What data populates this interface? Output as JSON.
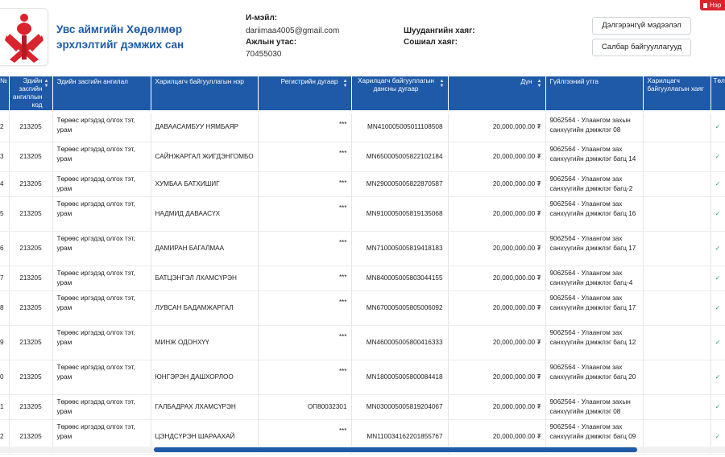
{
  "org": {
    "name": "Увс аймгийн Хөдөлмөр эрхлэлтийг дэмжих сан"
  },
  "contact": {
    "email_label": "И-мэйл:",
    "email_value": "dariimaa4005@gmail.com",
    "phone_label": "Ажлын утас:",
    "phone_value": "70455030",
    "address_label": "Шуудангийн хаяг:",
    "social_label": "Сошиал хаяг:"
  },
  "buttons": {
    "details": "Дэлгэрэнгүй мэдээлэл",
    "branches": "Салбар байгууллагууд",
    "corner": "Нэр"
  },
  "colors": {
    "primary": "#1e5aa8",
    "accent": "#d9232d",
    "success": "#2e9e5b"
  },
  "table": {
    "headers": [
      "№",
      "Эдийн засгийн ангиллын код",
      "Эдийн засгийн ангилал",
      "Харилцагч байгууллагын нэр",
      "Регистрийн дугаар",
      "Харилцагч байгууллагын дансны дугаар",
      "Дүн",
      "Гүйлгээний утга",
      "Харилцагч байгууллагын хаяг",
      "Төлөв"
    ],
    "rows": [
      {
        "no": "2",
        "code": "213205",
        "category": "Төрөөс иргэдэд олгох тэт, урам",
        "name": "ДАВААСАМБУУ НЯМБАЯР",
        "reg": "***",
        "account": "MN410005005011108508",
        "amount": "20,000,000.00 ₮",
        "desc": "9062564 - Улаангом захын санхүүгийн дэмжлэг 08",
        "address": "",
        "status": "✓"
      },
      {
        "no": "3",
        "code": "213205",
        "category": "Төрөөс иргэдэд олгох тэт, урам",
        "name": "САЙНЖАРГАЛ ЖИГДЭНГОМБО",
        "reg": "***",
        "account": "MN650005005822102184",
        "amount": "20,000,000.00 ₮",
        "desc": "9062564 - Улаангом зах санхүүгийн дэмжлэг багц 14",
        "address": "",
        "status": "✓"
      },
      {
        "no": "4",
        "code": "213205",
        "category": "Төрөөс иргэдэд олгох тэт, урам",
        "name": "ХУМБАА БАТХИШИГ",
        "reg": "***",
        "account": "MN290005005822870587",
        "amount": "20,000,000.00 ₮",
        "desc": "9062564 - Улаангом зах санхүүгийн дэмжлэг багц-2",
        "address": "",
        "status": "✓"
      },
      {
        "no": "5",
        "code": "213205",
        "category": "Төрөөс иргэдэд олгох тэт, урам",
        "name": "НАДМИД ДАВААСҮХ",
        "reg": "***",
        "account": "MN910005005819135068",
        "amount": "20,000,000.00 ₮",
        "desc": "9062564 - Улаангом зах санхүүгийн дэмжлэг багц 16",
        "address": "",
        "status": "✓"
      },
      {
        "no": "6",
        "code": "213205",
        "category": "Төрөөс иргэдэд олгох тэт, урам",
        "name": "ДАМИРАН БАГАЛМАА",
        "reg": "***",
        "account": "MN710005005819418183",
        "amount": "20,000,000.00 ₮",
        "desc": "9062564 - Улаангом зах санхүүгийн дэмжлэг багц 17",
        "address": "",
        "status": "✓"
      },
      {
        "no": "7",
        "code": "213205",
        "category": "Төрөөс иргэдэд олгох тэт, урам",
        "name": "БАТЦЭНГЭЛ ЛХАМСҮРЭН",
        "reg": "***",
        "account": "MN840005005803044155",
        "amount": "20,000,000.00 ₮",
        "desc": "9062564 - Улаангом зах санхүүгийн дэмжлэг багц-4",
        "address": "",
        "status": "✓"
      },
      {
        "no": "8",
        "code": "213205",
        "category": "Төрөөс иргэдэд олгох тэт, урам",
        "name": "ЛУВСАН БАДАМЖАРГАЛ",
        "reg": "***",
        "account": "MN670005005805006092",
        "amount": "20,000,000.00 ₮",
        "desc": "9062564 - Улаангом зах санхүүгийн дэмжлэг багц 17",
        "address": "",
        "status": "✓"
      },
      {
        "no": "9",
        "code": "213205",
        "category": "Төрөөс иргэдэд олгох тэт, урам",
        "name": "МИНЖ ОДОНХҮҮ",
        "reg": "***",
        "account": "MN460005005800416333",
        "amount": "20,000,000.00 ₮",
        "desc": "9062564 - Улаангом зах санхүүгийн дэмжлэг багц 12",
        "address": "",
        "status": "✓"
      },
      {
        "no": "0",
        "code": "213205",
        "category": "Төрөөс иргэдэд олгох тэт, урам",
        "name": "ЮНГЭРЭН ДАШХОРЛОО",
        "reg": "***",
        "account": "MN180005005800084418",
        "amount": "20,000,000.00 ₮",
        "desc": "9062564 - Улаангом зах санхүүгийн дэмжлэг багц 20",
        "address": "",
        "status": "✓"
      },
      {
        "no": "1",
        "code": "213205",
        "category": "Төрөөс иргэдэд олгох тэт, урам",
        "name": "ГАЛБАДРАХ ЛХАМСҮРЭН",
        "reg": "ОП80032301",
        "account": "MN030005005819204067",
        "amount": "20,000,000.00 ₮",
        "desc": "9062564 - Улаангом захын санхүүгийн дэмжлэг 08",
        "address": "",
        "status": "✓"
      },
      {
        "no": "2",
        "code": "213205",
        "category": "Төрөөс иргэдэд олгох тэт, урам",
        "name": "ЦЭНДСҮРЭН ШАРААХАЙ",
        "reg": "***",
        "account": "MN110034162201855767",
        "amount": "20,000,000.00 ₮",
        "desc": "9062564 - Улаангом зах санхүүгийн дэмжлэг багц 09",
        "address": "",
        "status": "✓"
      }
    ]
  }
}
